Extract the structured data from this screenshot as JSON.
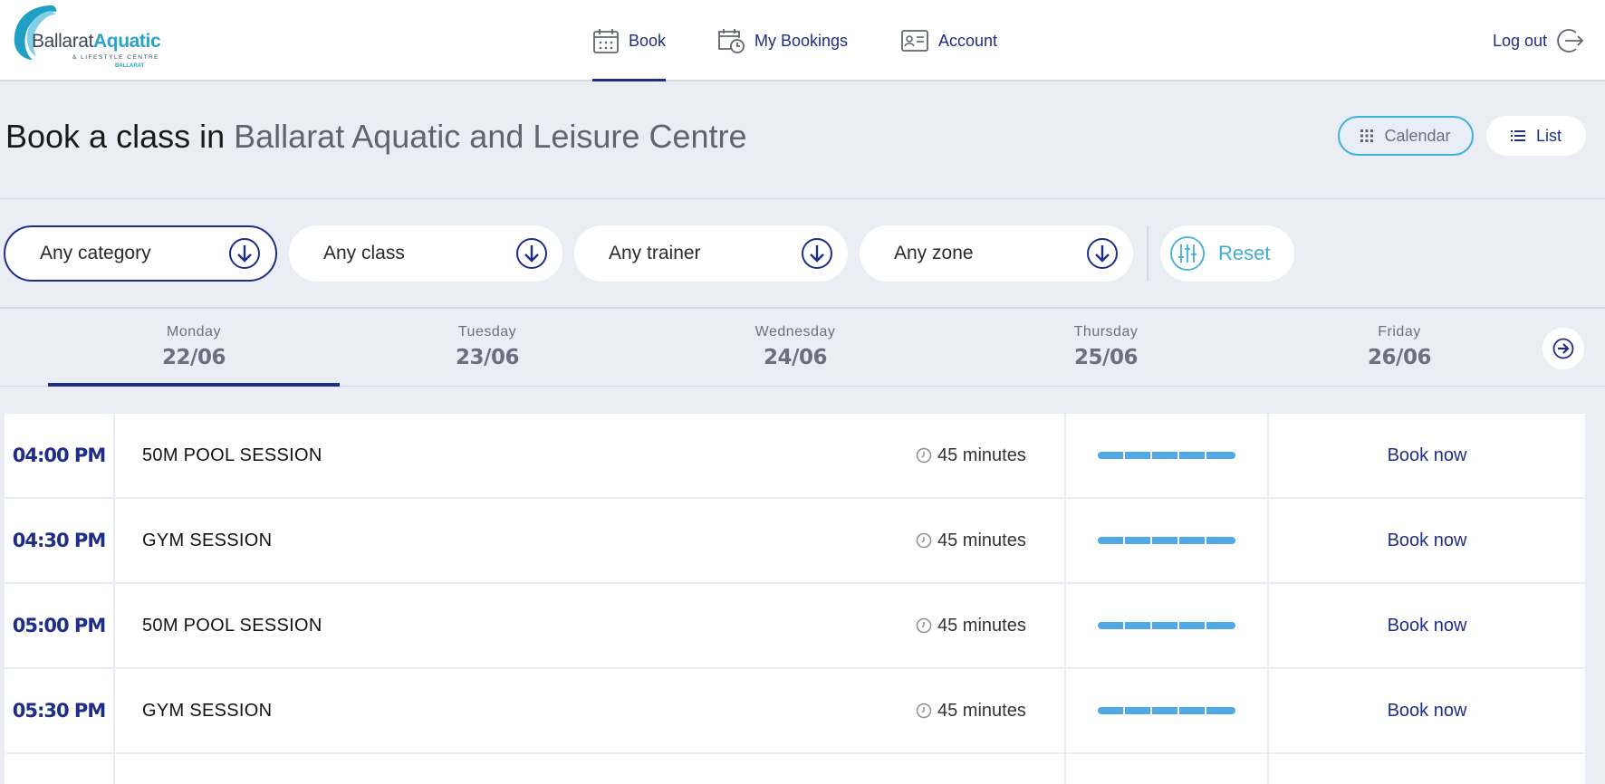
{
  "header": {
    "logo": {
      "word1": "Ballarat",
      "word2": "Aquatic",
      "tagline": "& LIFESTYLE CENTRE",
      "sub": "BALLARAT"
    },
    "nav": [
      {
        "label": "Book",
        "icon": "calendar-icon",
        "active": true
      },
      {
        "label": "My Bookings",
        "icon": "calendar-clock-icon",
        "active": false
      },
      {
        "label": "Account",
        "icon": "id-card-icon",
        "active": false
      }
    ],
    "logout_label": "Log out"
  },
  "title": {
    "prefix": "Book a class in",
    "venue": "Ballarat Aquatic and Leisure Centre"
  },
  "view_toggle": {
    "calendar": "Calendar",
    "list": "List",
    "selected": "Calendar"
  },
  "filters": {
    "category": "Any category",
    "class": "Any class",
    "trainer": "Any trainer",
    "zone": "Any zone",
    "reset": "Reset"
  },
  "days": [
    {
      "name": "Monday",
      "date": "22/06",
      "active": true
    },
    {
      "name": "Tuesday",
      "date": "23/06",
      "active": false
    },
    {
      "name": "Wednesday",
      "date": "24/06",
      "active": false
    },
    {
      "name": "Thursday",
      "date": "25/06",
      "active": false
    },
    {
      "name": "Friday",
      "date": "26/06",
      "active": false
    }
  ],
  "sessions": [
    {
      "time": "04:00 PM",
      "name": "50M POOL SESSION",
      "duration": "45 minutes",
      "action": "Book now"
    },
    {
      "time": "04:30 PM",
      "name": "GYM SESSION",
      "duration": "45 minutes",
      "action": "Book now"
    },
    {
      "time": "05:00 PM",
      "name": "50M POOL SESSION",
      "duration": "45 minutes",
      "action": "Book now"
    },
    {
      "time": "05:30 PM",
      "name": "GYM SESSION",
      "duration": "45 minutes",
      "action": "Book now"
    }
  ],
  "colors": {
    "brand": "#1f2d8a",
    "accent": "#3fb0d8",
    "capacity": "#4ea9e4",
    "background": "#ebedf4"
  }
}
